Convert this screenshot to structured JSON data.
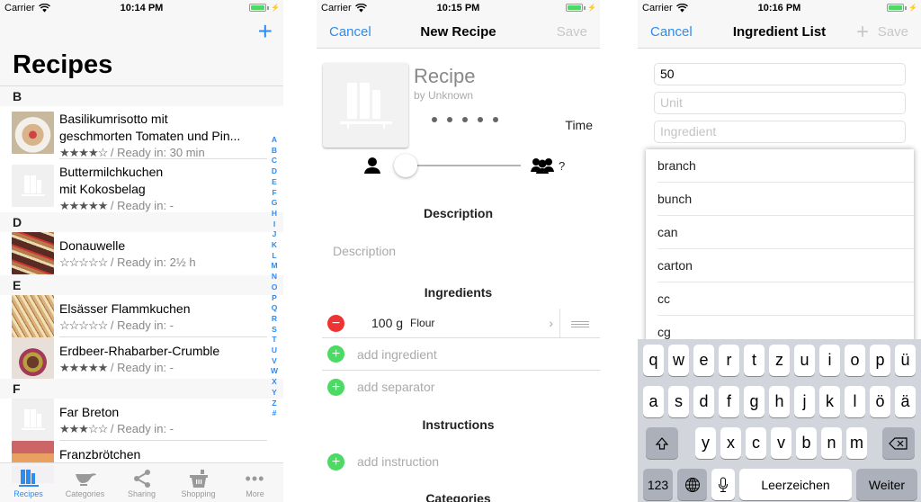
{
  "screens": {
    "recipes": {
      "status": {
        "carrier": "Carrier",
        "time": "10:14 PM"
      },
      "add_icon": "+",
      "title": "Recipes",
      "sections": [
        {
          "letter": "B",
          "recipes": [
            {
              "title_line1": "Basilikumrisotto mit",
              "title_line2": "geschmorten Tomaten und Pin...",
              "stars": "★★★★☆",
              "ready": " / Ready in: 30 min",
              "thumb": "risotto"
            },
            {
              "title_line1": "Buttermilchkuchen",
              "title_line2": "mit Kokosbelag",
              "stars": "★★★★★",
              "ready": " / Ready in: -",
              "thumb": "placeholder"
            }
          ]
        },
        {
          "letter": "D",
          "recipes": [
            {
              "title_line1": "Donauwelle",
              "stars": "☆☆☆☆☆",
              "ready": " / Ready in: 2½ h",
              "thumb": "donauwelle"
            }
          ]
        },
        {
          "letter": "E",
          "recipes": [
            {
              "title_line1": "Elsässer Flammkuchen",
              "stars": "☆☆☆☆☆",
              "ready": " / Ready in: -",
              "thumb": "flammkuchen"
            },
            {
              "title_line1": "Erdbeer-Rhabarber-Crumble",
              "stars": "★★★★★",
              "ready": " / Ready in: -",
              "thumb": "crumble"
            }
          ]
        },
        {
          "letter": "F",
          "recipes": [
            {
              "title_line1": "Far Breton",
              "stars": "★★★☆☆",
              "ready": " / Ready in: -",
              "thumb": "placeholder"
            },
            {
              "title_line1": "Franzbrötchen",
              "thumb": "franzbroetchen"
            }
          ]
        }
      ],
      "index": [
        "A",
        "B",
        "C",
        "D",
        "E",
        "F",
        "G",
        "H",
        "I",
        "J",
        "K",
        "L",
        "M",
        "N",
        "O",
        "P",
        "Q",
        "R",
        "S",
        "T",
        "U",
        "V",
        "W",
        "X",
        "Y",
        "Z",
        "#"
      ],
      "tabs": [
        {
          "label": "Recipes",
          "icon": "books-icon",
          "active": true
        },
        {
          "label": "Categories",
          "icon": "gravy-boat-icon"
        },
        {
          "label": "Sharing",
          "icon": "share-icon"
        },
        {
          "label": "Shopping",
          "icon": "basket-icon"
        },
        {
          "label": "More",
          "icon": "more-icon"
        }
      ]
    },
    "new_recipe": {
      "status": {
        "carrier": "Carrier",
        "time": "10:15 PM"
      },
      "nav": {
        "cancel": "Cancel",
        "title": "New Recipe",
        "save": "Save"
      },
      "recipe_name": "Recipe",
      "author": "by Unknown",
      "rating_dots": 5,
      "time_label": "Time",
      "servings_value": "?",
      "servings_slider_fraction": 0.0,
      "description_header": "Description",
      "description_placeholder": "Description",
      "ingredients_header": "Ingredients",
      "ingredients": [
        {
          "amount": "100 g",
          "name": "Flour"
        }
      ],
      "add_ingredient": "add ingredient",
      "add_separator": "add separator",
      "instructions_header": "Instructions",
      "add_instruction": "add instruction",
      "categories_header": "Categories"
    },
    "ingredient_list": {
      "status": {
        "carrier": "Carrier",
        "time": "10:16 PM"
      },
      "nav": {
        "cancel": "Cancel",
        "title": "Ingredient List",
        "add": "+",
        "save": "Save"
      },
      "amount_value": "50",
      "unit_placeholder": "Unit",
      "ingredient_placeholder": "Ingredient",
      "suggestions": [
        "branch",
        "bunch",
        "can",
        "carton",
        "cc",
        "cg"
      ],
      "keyboard": {
        "row1": [
          "q",
          "w",
          "e",
          "r",
          "t",
          "z",
          "u",
          "i",
          "o",
          "p",
          "ü"
        ],
        "row2": [
          "a",
          "s",
          "d",
          "f",
          "g",
          "h",
          "j",
          "k",
          "l",
          "ö",
          "ä"
        ],
        "row3": [
          "y",
          "x",
          "c",
          "v",
          "b",
          "n",
          "m"
        ],
        "numbers": "123",
        "space": "Leerzeichen",
        "return": "Weiter"
      }
    }
  },
  "colors": {
    "accent": "#2d8cf0",
    "delete": "#ee3333",
    "add": "#4cd964",
    "battery": "#4cd964"
  }
}
